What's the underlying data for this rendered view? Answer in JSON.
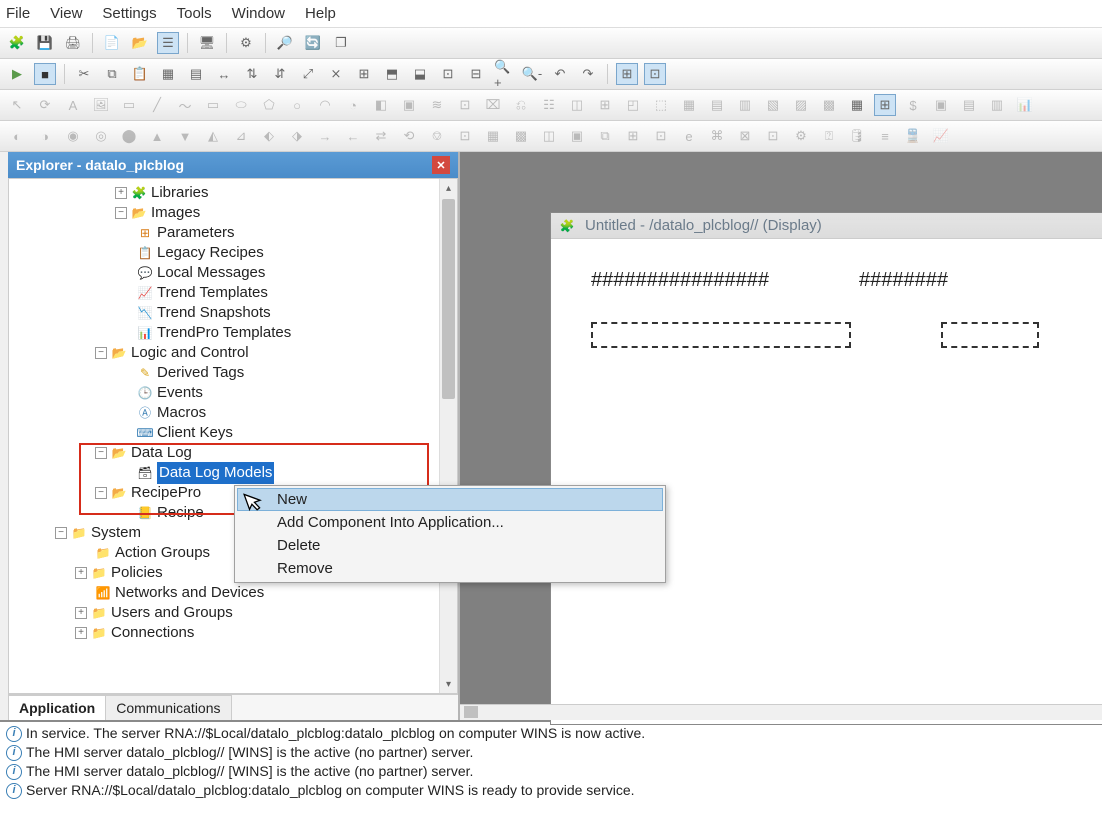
{
  "menu": {
    "items": [
      "File",
      "View",
      "Settings",
      "Tools",
      "Window",
      "Help"
    ]
  },
  "explorer": {
    "title_prefix": "Explorer - ",
    "project": "datalo_plcblog",
    "tree": {
      "libraries": "Libraries",
      "images": "Images",
      "parameters": "Parameters",
      "legacy_recipes": "Legacy Recipes",
      "local_messages": "Local Messages",
      "trend_templates": "Trend Templates",
      "trend_snapshots": "Trend Snapshots",
      "trendpro_templates": "TrendPro Templates",
      "logic_and_control": "Logic and Control",
      "derived_tags": "Derived Tags",
      "events": "Events",
      "macros": "Macros",
      "client_keys": "Client Keys",
      "data_log": "Data Log",
      "data_log_models": "Data Log Models",
      "recipepro": "RecipePro",
      "recipe": "Recipe",
      "system": "System",
      "action_groups": "Action Groups",
      "policies": "Policies",
      "networks_and_devices": "Networks and Devices",
      "users_and_groups": "Users and Groups",
      "connections": "Connections"
    },
    "tabs": {
      "application": "Application",
      "communications": "Communications"
    }
  },
  "context_menu": {
    "new": "New",
    "add_component": "Add Component Into Application...",
    "delete": "Delete",
    "remove": "Remove"
  },
  "document": {
    "title": "Untitled - /datalo_plcblog// (Display)",
    "hash1": "################",
    "hash2": "########"
  },
  "log": {
    "l1": "In service. The server RNA://$Local/datalo_plcblog:datalo_plcblog on computer WINS is now active.",
    "l2": "The HMI server  datalo_plcblog// [WINS] is the active (no partner) server.",
    "l3": "The HMI server  datalo_plcblog// [WINS] is the active (no partner) server.",
    "l4": "Server RNA://$Local/datalo_plcblog:datalo_plcblog on computer WINS is ready to provide service."
  }
}
